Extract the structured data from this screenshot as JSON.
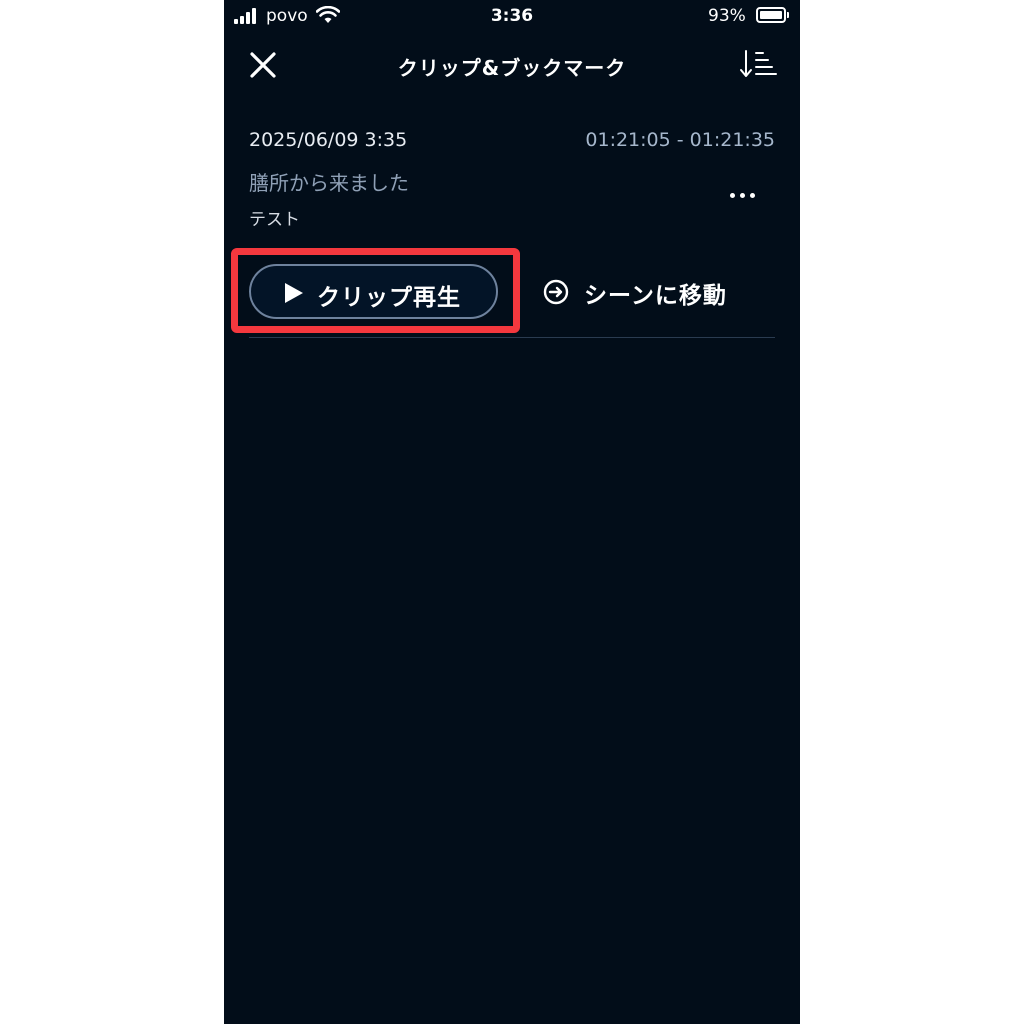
{
  "status_bar": {
    "carrier": "povo",
    "time": "3:36",
    "battery_percent": "93%",
    "battery_level": 0.93
  },
  "header": {
    "title": "クリップ&ブックマーク",
    "close_icon": "close-icon",
    "sort_icon": "sort-icon"
  },
  "clips": [
    {
      "date": "2025/06/09 3:35",
      "range": "01:21:05 - 01:21:35",
      "title": "膳所から来ました",
      "note": "テスト",
      "play_label": "クリップ再生",
      "scene_label": "シーンに移動",
      "more_icon": "more-icon"
    }
  ],
  "colors": {
    "background": "#020d19",
    "highlight": "#f4383e",
    "button_border": "#6e829d",
    "muted_text": "#8fa0b6"
  }
}
